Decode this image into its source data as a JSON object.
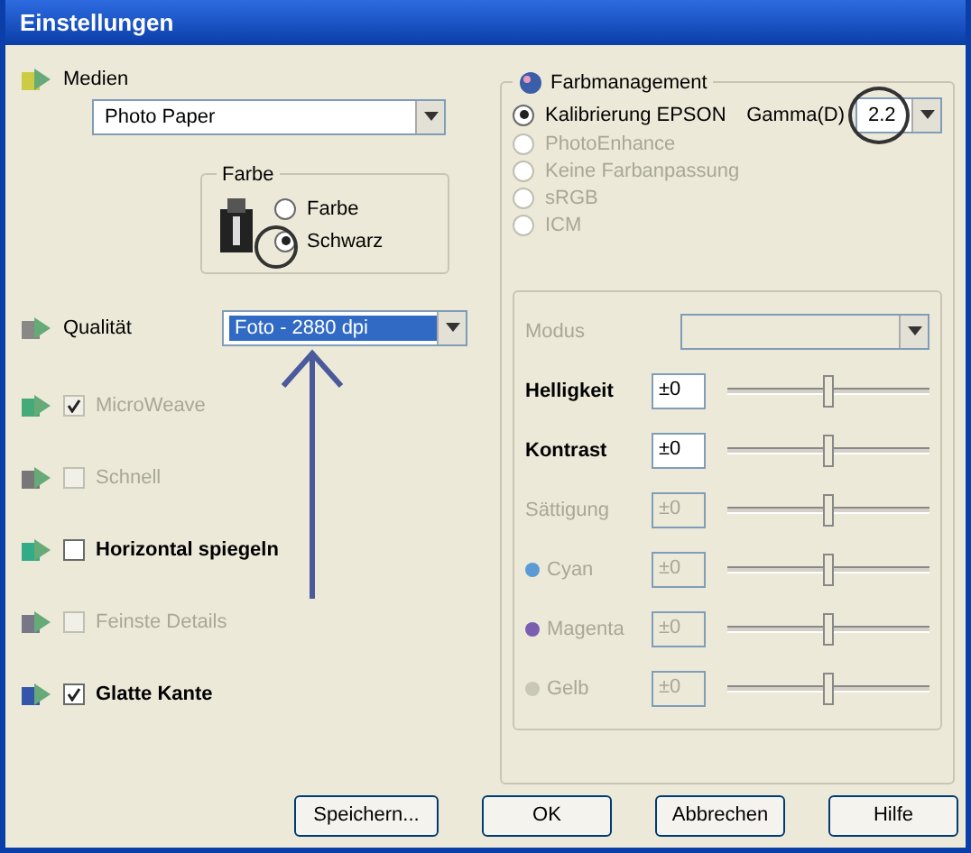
{
  "window": {
    "title": "Einstellungen"
  },
  "media": {
    "label": "Medien",
    "value": "Photo Paper"
  },
  "ink": {
    "title": "Farbe",
    "options": [
      {
        "label": "Farbe",
        "selected": false
      },
      {
        "label": "Schwarz",
        "selected": true
      }
    ]
  },
  "quality": {
    "label": "Qualität",
    "value": "Foto - 2880 dpi",
    "focused": true
  },
  "options": [
    {
      "label": "MicroWeave",
      "checked": true,
      "disabled": true
    },
    {
      "label": "Schnell",
      "checked": false,
      "disabled": true
    },
    {
      "label": "Horizontal spiegeln",
      "checked": false,
      "disabled": false
    },
    {
      "label": "Feinste Details",
      "checked": false,
      "disabled": true
    },
    {
      "label": "Glatte Kante",
      "checked": true,
      "disabled": false
    }
  ],
  "color_management": {
    "title": "Farbmanagement",
    "modes": [
      {
        "label": "Kalibrierung EPSON",
        "selected": true,
        "disabled": false
      },
      {
        "label": "PhotoEnhance",
        "selected": false,
        "disabled": true
      },
      {
        "label": "Keine Farbanpassung",
        "selected": false,
        "disabled": true
      },
      {
        "label": "sRGB",
        "selected": false,
        "disabled": true
      },
      {
        "label": "ICM",
        "selected": false,
        "disabled": true
      }
    ],
    "gamma": {
      "label": "Gamma(D)",
      "value": "2.2"
    },
    "mode": {
      "label": "Modus",
      "disabled": true
    },
    "adjustments": [
      {
        "label": "Helligkeit",
        "value": "±0",
        "level": 0.5,
        "disabled": false
      },
      {
        "label": "Kontrast",
        "value": "±0",
        "level": 0.5,
        "disabled": false
      },
      {
        "label": "Sättigung",
        "value": "±0",
        "level": 0.5,
        "disabled": true
      },
      {
        "label": "Cyan",
        "value": "±0",
        "level": 0.5,
        "disabled": true,
        "color": "#5b9bd5"
      },
      {
        "label": "Magenta",
        "value": "±0",
        "level": 0.5,
        "disabled": true,
        "color": "#7a5fb0"
      },
      {
        "label": "Gelb",
        "value": "±0",
        "level": 0.5,
        "disabled": true,
        "color": "#c8c8b4"
      }
    ]
  },
  "buttons": [
    "Speichern...",
    "OK",
    "Abbrechen",
    "Hilfe"
  ]
}
